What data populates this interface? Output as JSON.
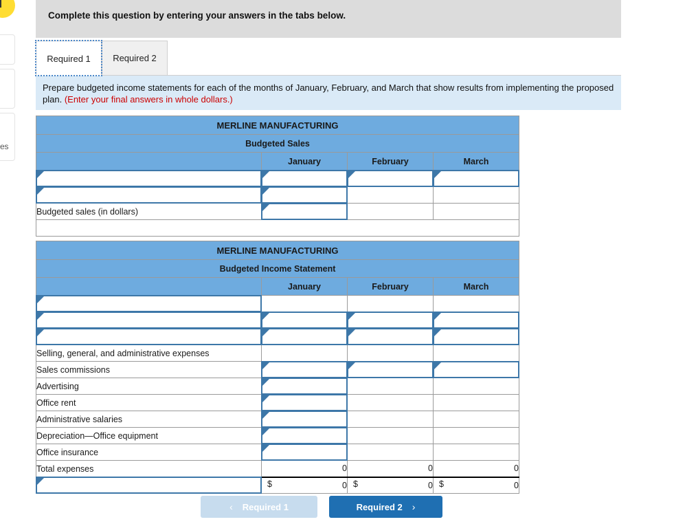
{
  "prompt": {
    "text": "Complete this question by entering your answers in the tabs below."
  },
  "tabs": [
    {
      "label": "Required 1",
      "active": true
    },
    {
      "label": "Required 2",
      "active": false
    }
  ],
  "instruction": {
    "main": "Prepare budgeted income statements for each of the months of January, February, and March that show results from implementing the proposed plan.",
    "note": "(Enter your final answers in whole dollars.)"
  },
  "sales_table": {
    "company": "MERLINE MANUFACTURING",
    "statement": "Budgeted Sales",
    "columns": [
      "",
      "January",
      "February",
      "March"
    ],
    "rows": [
      {
        "label": "",
        "label_input": true,
        "cells": [
          "",
          "",
          ""
        ],
        "inputs": [
          true,
          true,
          true
        ]
      },
      {
        "label": "",
        "label_input": true,
        "cells": [
          "",
          "",
          ""
        ],
        "inputs": [
          true,
          false,
          false
        ]
      },
      {
        "label": "Budgeted sales (in dollars)",
        "label_input": false,
        "cells": [
          "",
          "",
          ""
        ],
        "inputs": [
          true,
          false,
          false
        ]
      }
    ]
  },
  "income_table": {
    "company": "MERLINE MANUFACTURING",
    "statement": "Budgeted Income Statement",
    "columns": [
      "",
      "January",
      "February",
      "March"
    ],
    "rows": [
      {
        "label": "",
        "label_input": true,
        "cells": [
          "",
          "",
          ""
        ],
        "inputs": [
          false,
          false,
          false
        ]
      },
      {
        "label": "",
        "label_input": true,
        "cells": [
          "",
          "",
          ""
        ],
        "inputs": [
          true,
          true,
          true
        ]
      },
      {
        "label": "",
        "label_input": true,
        "cells": [
          "",
          "",
          ""
        ],
        "inputs": [
          true,
          true,
          true
        ]
      },
      {
        "label": "Selling, general, and administrative expenses",
        "label_input": false,
        "cells": [
          "",
          "",
          ""
        ],
        "inputs": [
          false,
          false,
          false
        ]
      },
      {
        "label": "Sales commissions",
        "indent": true,
        "label_input": false,
        "cells": [
          "",
          "",
          ""
        ],
        "inputs": [
          true,
          true,
          true
        ]
      },
      {
        "label": "Advertising",
        "indent": true,
        "label_input": false,
        "cells": [
          "",
          "",
          ""
        ],
        "inputs": [
          true,
          false,
          false
        ]
      },
      {
        "label": "Office rent",
        "indent": true,
        "label_input": false,
        "cells": [
          "",
          "",
          ""
        ],
        "inputs": [
          true,
          false,
          false
        ]
      },
      {
        "label": "Administrative salaries",
        "indent": true,
        "label_input": false,
        "cells": [
          "",
          "",
          ""
        ],
        "inputs": [
          true,
          false,
          false
        ]
      },
      {
        "label": "Depreciation—Office equipment",
        "indent": true,
        "label_input": false,
        "cells": [
          "",
          "",
          ""
        ],
        "inputs": [
          true,
          false,
          false
        ]
      },
      {
        "label": "Office insurance",
        "indent": true,
        "label_input": false,
        "cells": [
          "",
          "",
          ""
        ],
        "inputs": [
          true,
          false,
          false
        ]
      }
    ],
    "total_row": {
      "label": "Total expenses",
      "cells": [
        "0",
        "0",
        "0"
      ]
    },
    "net_row": {
      "label": "",
      "label_input": true,
      "currency": "$",
      "cells": [
        "0",
        "0",
        "0"
      ]
    }
  },
  "footer": {
    "prev_label": "Required 1",
    "next_label": "Required 2",
    "prev_chevron": "‹",
    "next_chevron": "›"
  },
  "sidebar_fragment": {
    "text": "es"
  }
}
